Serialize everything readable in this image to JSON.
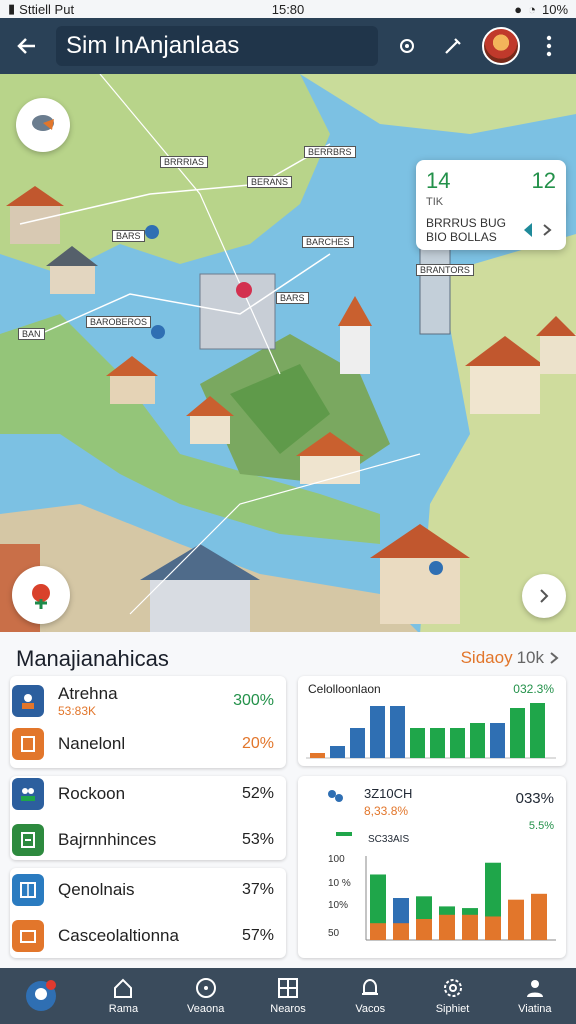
{
  "status": {
    "carrier": "Sttiell Put",
    "time": "15:80",
    "battery": "10%"
  },
  "appbar": {
    "title": "Sim InAnjanlaas"
  },
  "map": {
    "card": {
      "left_value": "14",
      "right_value": "12",
      "sub_left": "TIK",
      "line1": "BRRRUS BUG",
      "line2": "BIO BOLLAS"
    },
    "labels": [
      "BRRRIAS",
      "BERRBRS",
      "BERANS",
      "BRANTORS",
      "BAROBEROS",
      "BARCHES",
      "BARS",
      "BARS",
      "BAN"
    ]
  },
  "panel": {
    "heading": "Manajianahicas",
    "link_label": "Sidaoy",
    "link_count": "10k",
    "items": [
      {
        "name": "Atrehna",
        "sub": "53:83K",
        "value": "300%",
        "value_color": "#23914a"
      },
      {
        "name": "Nanelonl",
        "sub": "",
        "value": "20%",
        "value_color": "#e2762b"
      },
      {
        "name": "Rockoon",
        "sub": "",
        "value": "52%",
        "value_color": "#222222"
      },
      {
        "name": "Bajrnnhinces",
        "sub": "",
        "value": "53%",
        "value_color": "#222222"
      },
      {
        "name": "Qenolnais",
        "sub": "",
        "value": "37%",
        "value_color": "#222222"
      },
      {
        "name": "Casceolaltionna",
        "sub": "",
        "value": "57%",
        "value_color": "#222222"
      }
    ]
  },
  "chart_top": {
    "title": "Celolloonlaon",
    "value": "032.3%",
    "chart_data": {
      "type": "bar",
      "series": [
        {
          "values": [
            5,
            12,
            30,
            52,
            52,
            30,
            30,
            30,
            35,
            35,
            50,
            55
          ]
        }
      ],
      "colors": [
        "#e2762b",
        "#2f6fb3",
        "#2f6fb3",
        "#2f6fb3",
        "#2f6fb3",
        "#1fa64a",
        "#1fa64a",
        "#1fa64a",
        "#1fa64a",
        "#2f6fb3",
        "#1fa64a",
        "#1fa64a"
      ]
    }
  },
  "chart_bottom": {
    "title": "3Z10CH",
    "value": "033%",
    "sub": "8,33.8%",
    "sub2": "5.5%",
    "label": "SC33AIS",
    "ticks": [
      "100",
      "10 %",
      "10%",
      "50"
    ],
    "chart_data": {
      "type": "bar",
      "series": [
        {
          "values": [
            78,
            50,
            52,
            40,
            38,
            92,
            48,
            55
          ]
        },
        {
          "values": [
            20,
            20,
            25,
            30,
            30,
            28,
            25,
            20
          ]
        }
      ],
      "colors": [
        "#1fa64a",
        "#2f6fb3",
        "#1fa64a",
        "#1fa64a",
        "#1fa64a",
        "#1fa64a",
        "#e2762b",
        "#e2762b"
      ]
    }
  },
  "nav": [
    {
      "label": "Rama",
      "icon": "home-icon"
    },
    {
      "label": "Veaona",
      "icon": "compass-icon"
    },
    {
      "label": "Nearos",
      "icon": "grid-icon"
    },
    {
      "label": "Vacos",
      "icon": "bell-icon"
    },
    {
      "label": "Siphiet",
      "icon": "gear-icon"
    },
    {
      "label": "Viatina",
      "icon": "profile-icon"
    }
  ]
}
